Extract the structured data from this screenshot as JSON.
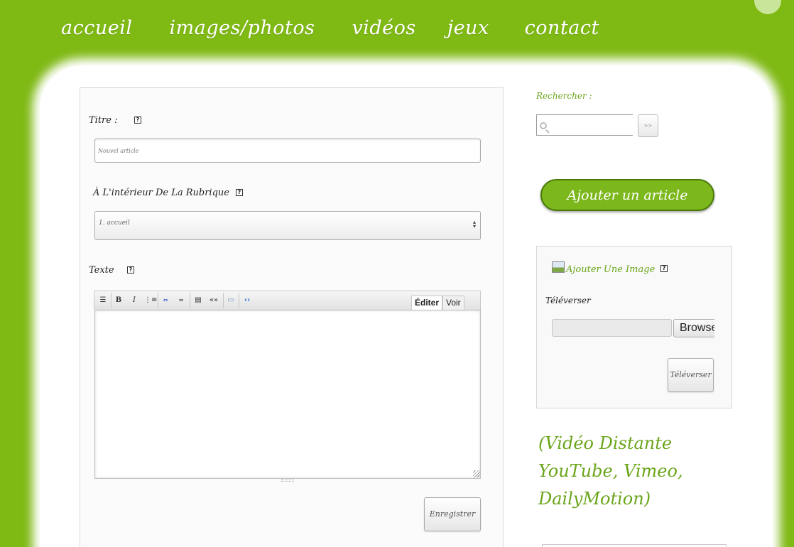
{
  "nav": {
    "items": [
      "accueil",
      "images/photos",
      "vidéos",
      "jeux",
      "contact"
    ]
  },
  "form": {
    "title_label": "Titre :",
    "title_placeholder": "Nouvel article",
    "rubrique_label": "À L'intérieur De La Rubrique",
    "rubrique_selected": "1. accueil",
    "texte_label": "Texte",
    "help_glyph": "?",
    "toolbar": {
      "buttons": [
        "paragraph-icon",
        "bold-icon",
        "italic-icon",
        "list-icon",
        "link-icon",
        "unlink-icon",
        "align-icon",
        "quote-icon",
        "image-icon",
        "code-icon"
      ],
      "bold": "B",
      "italic": "I",
      "tabs": [
        "Éditer",
        "Voir"
      ]
    },
    "save_label": "Enregistrer"
  },
  "sidebar": {
    "search_label": "Rechercher :",
    "search_go": ">>",
    "add_article_label": "Ajouter un article",
    "image_panel": {
      "title": "Ajouter Une Image",
      "upload_label": "Téléverser",
      "browse_label": "Browse...",
      "upload_button": "Téléverser"
    },
    "video_title": "(Vidéo Distante YouTube, Vimeo, DailyMotion)"
  },
  "colors": {
    "background_green": "#7fb914",
    "accent_green": "#6aa51a",
    "button_green": "#7cb81c"
  }
}
